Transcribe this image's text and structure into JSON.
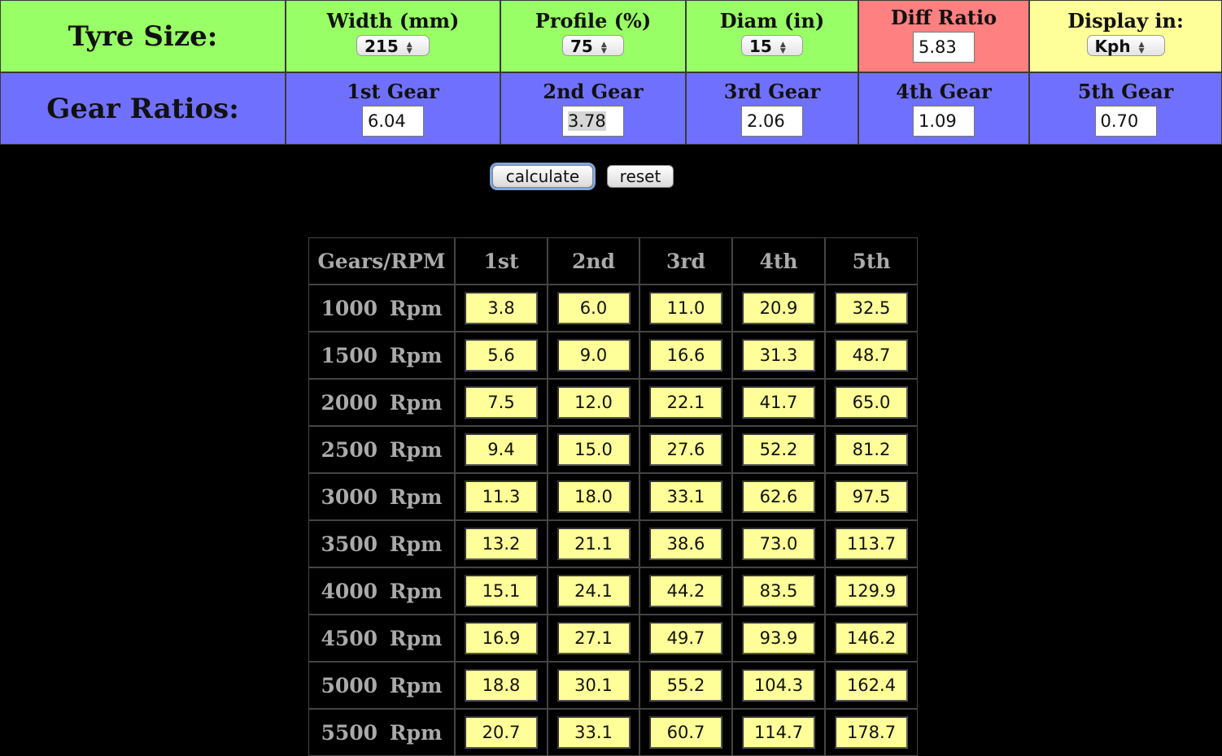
{
  "tyre": {
    "label": "Tyre Size:",
    "width": {
      "header": "Width (mm)",
      "value": "215"
    },
    "profile": {
      "header": "Profile (%)",
      "value": "75"
    },
    "diam": {
      "header": "Diam (in)",
      "value": "15"
    },
    "diff": {
      "header": "Diff Ratio",
      "value": "5.83"
    },
    "display": {
      "header": "Display in:",
      "value": "Kph"
    }
  },
  "gears": {
    "label": "Gear Ratios:",
    "items": [
      {
        "header": "1st Gear",
        "value": "6.04"
      },
      {
        "header": "2nd Gear",
        "value": "3.78"
      },
      {
        "header": "3rd Gear",
        "value": "2.06"
      },
      {
        "header": "4th Gear",
        "value": "1.09"
      },
      {
        "header": "5th Gear",
        "value": "0.70"
      }
    ]
  },
  "buttons": {
    "calculate": "calculate",
    "reset": "reset"
  },
  "table": {
    "headers": [
      "Gears/RPM",
      "1st",
      "2nd",
      "3rd",
      "4th",
      "5th"
    ],
    "rows": [
      {
        "rpm": "1000 Rpm",
        "values": [
          "3.8",
          "6.0",
          "11.0",
          "20.9",
          "32.5"
        ]
      },
      {
        "rpm": "1500 Rpm",
        "values": [
          "5.6",
          "9.0",
          "16.6",
          "31.3",
          "48.7"
        ]
      },
      {
        "rpm": "2000 Rpm",
        "values": [
          "7.5",
          "12.0",
          "22.1",
          "41.7",
          "65.0"
        ]
      },
      {
        "rpm": "2500 Rpm",
        "values": [
          "9.4",
          "15.0",
          "27.6",
          "52.2",
          "81.2"
        ]
      },
      {
        "rpm": "3000 Rpm",
        "values": [
          "11.3",
          "18.0",
          "33.1",
          "62.6",
          "97.5"
        ]
      },
      {
        "rpm": "3500 Rpm",
        "values": [
          "13.2",
          "21.1",
          "38.6",
          "73.0",
          "113.7"
        ]
      },
      {
        "rpm": "4000 Rpm",
        "values": [
          "15.1",
          "24.1",
          "44.2",
          "83.5",
          "129.9"
        ]
      },
      {
        "rpm": "4500 Rpm",
        "values": [
          "16.9",
          "27.1",
          "49.7",
          "93.9",
          "146.2"
        ]
      },
      {
        "rpm": "5000 Rpm",
        "values": [
          "18.8",
          "30.1",
          "55.2",
          "104.3",
          "162.4"
        ]
      },
      {
        "rpm": "5500 Rpm",
        "values": [
          "20.7",
          "33.1",
          "60.7",
          "114.7",
          "178.7"
        ]
      }
    ]
  },
  "colors": {
    "tyre_row": "#99ff66",
    "gear_row": "#7070ff",
    "diff": "#ff8080",
    "display": "#ffff99",
    "result_cell": "#ffff99"
  }
}
